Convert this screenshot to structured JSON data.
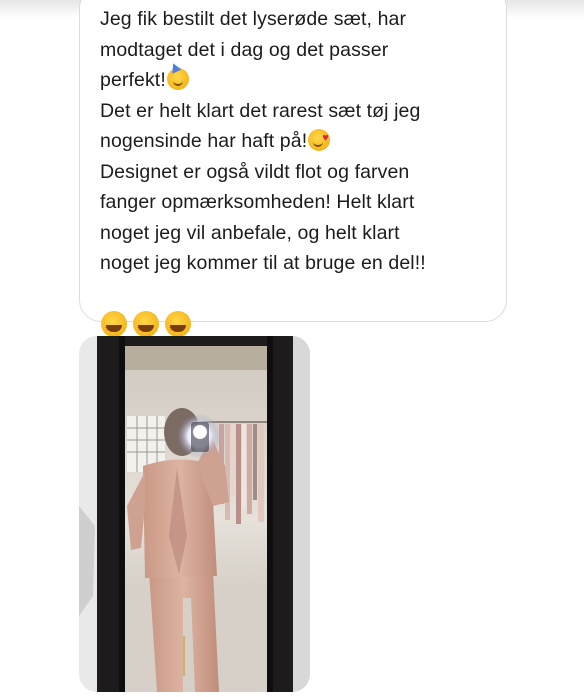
{
  "message": {
    "lines": [
      "Jeg fik bestilt det lyserøde sæt, har\nmodtaget det i dag og det passer\nperfekt!",
      "Det er helt klart det rarest sæt tøj jeg\nnogensinde har haft på!",
      "Designet er også vildt flot og farven\nfanger opmærksomheden! Helt klart\nnoget jeg vil anbefale, og helt klart\nnoget jeg kommer til at bruge en del!!"
    ],
    "emoji": {
      "line1": "partying-face-emoji",
      "line2": "smiling-face-with-hearts-emoji",
      "line3": "star-struck-emoji",
      "star_struck_count": 3
    }
  },
  "photo": {
    "subject": "mirror-selfie-pink-suit-image"
  },
  "colors": {
    "bubble_border": "#dcdcdc",
    "text": "#1c1c1c",
    "suit_pink": "#d7ab98"
  }
}
